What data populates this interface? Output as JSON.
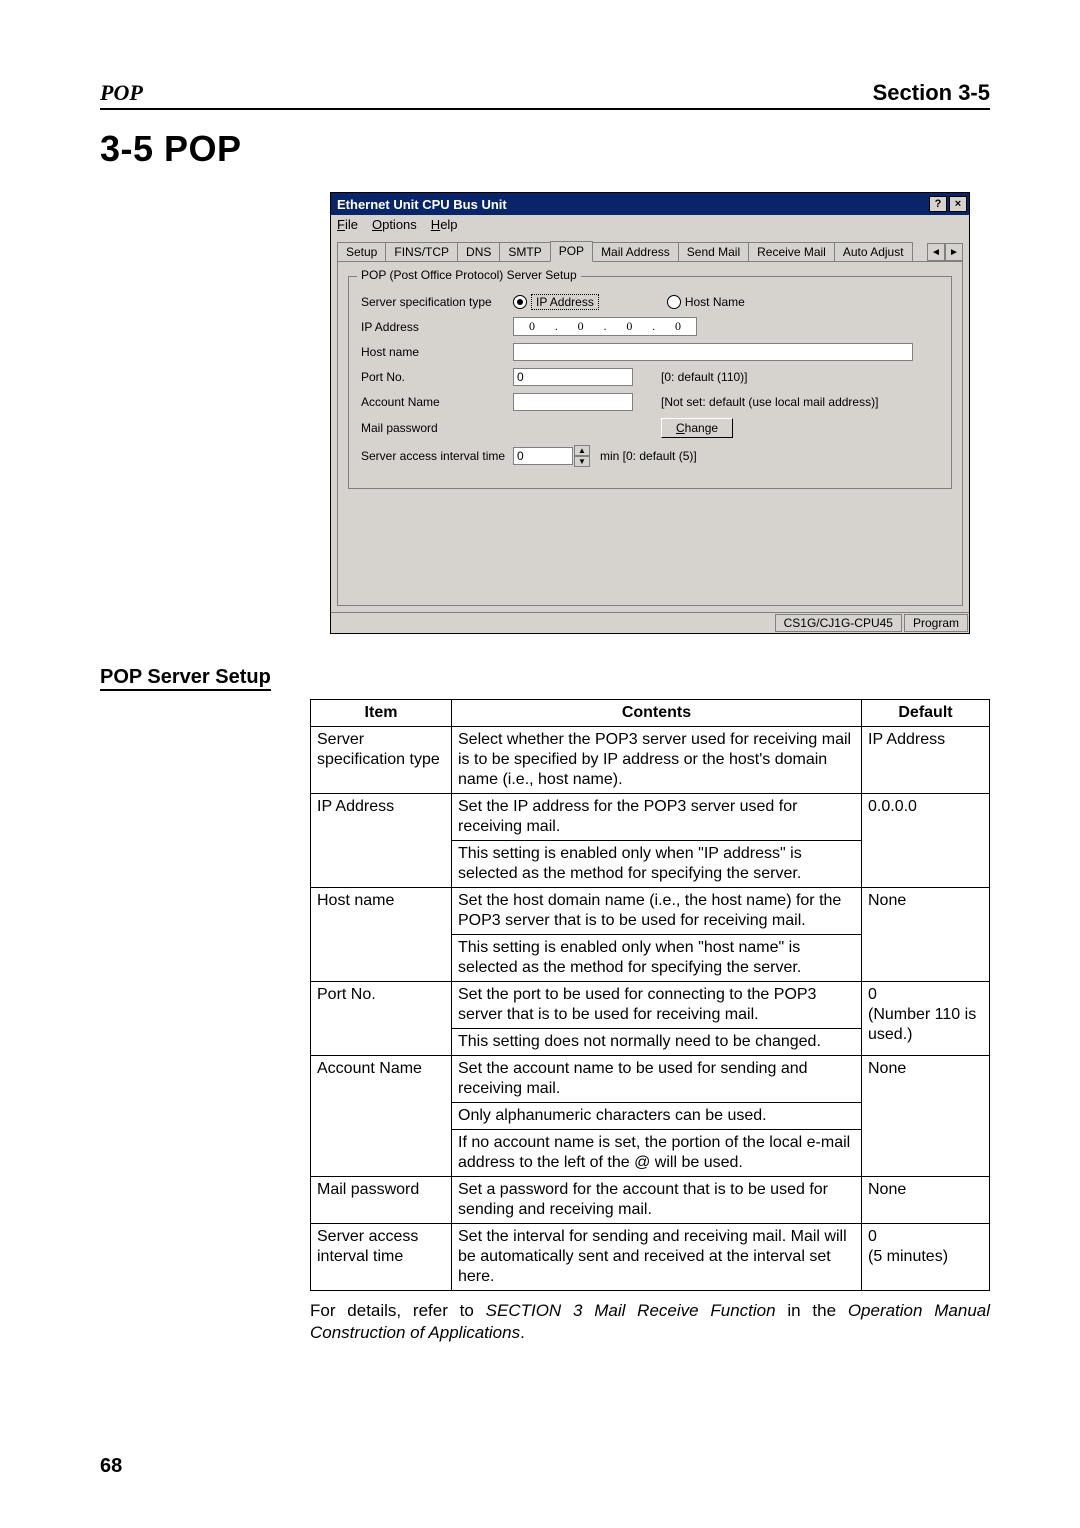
{
  "header": {
    "left": "POP",
    "right": "Section 3-5"
  },
  "title": "3-5   POP",
  "win": {
    "title": "Ethernet Unit CPU Bus Unit",
    "btn_help": "?",
    "btn_close": "×",
    "menu": {
      "file": "File",
      "options": "Options",
      "help": "Help"
    },
    "tabs": {
      "setup": "Setup",
      "fins": "FINS/TCP",
      "dns": "DNS",
      "smtp": "SMTP",
      "pop": "POP",
      "mailaddr": "Mail Address",
      "send": "Send Mail",
      "recv": "Receive Mail",
      "auto": "Auto Adjust"
    },
    "scroll_left": "◄",
    "scroll_right": "►",
    "group_legend": "POP (Post Office Protocol) Server Setup",
    "labels": {
      "spec": "Server specification type",
      "ip": "IP Address",
      "host": "Host name",
      "port": "Port No.",
      "account": "Account Name",
      "password": "Mail password",
      "interval": "Server access interval time"
    },
    "radio": {
      "ip": "IP Address",
      "host": "Host Name"
    },
    "ip_octets": [
      "0",
      "0",
      "0",
      "0"
    ],
    "host_value": "",
    "port_value": "0",
    "port_hint": "[0: default (110)]",
    "account_value": "",
    "account_hint": "[Not set: default (use local mail address)]",
    "change_btn": "Change",
    "interval_value": "0",
    "interval_unit_hint": "min   [0: default (5)]",
    "status": {
      "cpu": "CS1G/CJ1G-CPU45",
      "mode": "Program"
    }
  },
  "subtitle": "POP Server Setup",
  "table": {
    "headers": {
      "item": "Item",
      "contents": "Contents",
      "default": "Default"
    },
    "rows": [
      {
        "item": "Server specification type",
        "contents": [
          "Select whether the POP3 server used for receiving mail is to be specified by IP address or the host's domain name (i.e., host name)."
        ],
        "default": "IP Address"
      },
      {
        "item": "IP Address",
        "contents": [
          "Set the IP address for the POP3 server used for receiving mail.",
          "This setting is enabled only when \"IP address\" is selected as the method for specifying the server."
        ],
        "default": "0.0.0.0"
      },
      {
        "item": "Host name",
        "contents": [
          "Set the host domain name (i.e., the host name) for the POP3 server that is to be used for receiving mail.",
          "This setting is enabled only when \"host name\" is selected as the method for specifying the server."
        ],
        "default": "None"
      },
      {
        "item": "Port No.",
        "contents": [
          "Set the port to be used for connecting to the POP3 server that is to be used for receiving mail.",
          "This setting does not normally need to be changed."
        ],
        "default": "0\n(Number 110 is used.)"
      },
      {
        "item": "Account Name",
        "contents": [
          "Set the account name to be used for sending and receiving mail.",
          "Only alphanumeric characters can be used.",
          "If no account name is set, the portion of the local e-mail address to the left of the @ will be used."
        ],
        "default": "None"
      },
      {
        "item": "Mail password",
        "contents": [
          "Set a password for the account that is to be used for sending and receiving mail."
        ],
        "default": "None"
      },
      {
        "item": "Server access interval time",
        "contents": [
          "Set the interval for sending and receiving mail. Mail will be automatically sent and received at the interval set here."
        ],
        "default": "0\n(5 minutes)"
      }
    ]
  },
  "footnote": {
    "pre": "For details, refer to ",
    "ital1": "SECTION 3 Mail Receive Function",
    "mid": " in the ",
    "ital2": "Operation Manual Construction of Applications",
    "post": "."
  },
  "pagenum": "68"
}
